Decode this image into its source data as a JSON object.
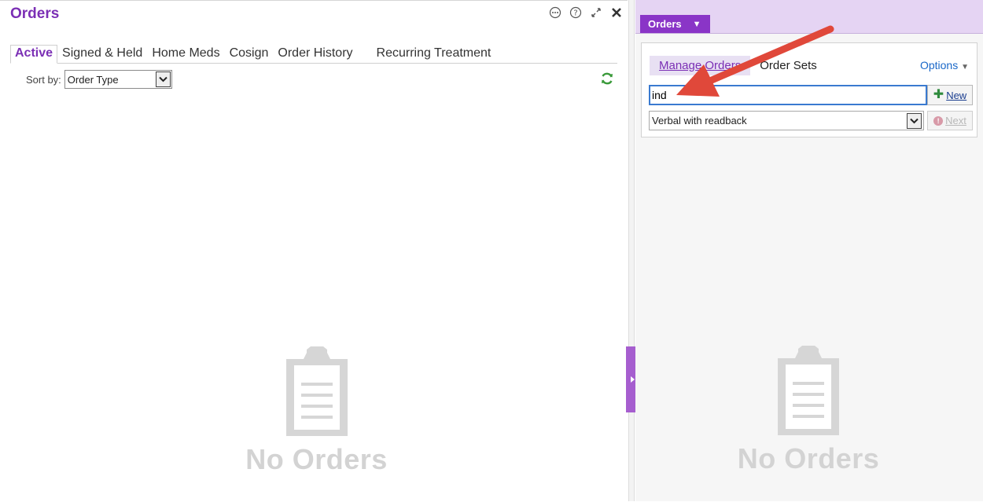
{
  "left": {
    "title": "Orders",
    "tabs": [
      "Active",
      "Signed & Held",
      "Home Meds",
      "Cosign",
      "Order History",
      "Recurring Treatment"
    ],
    "sort_label": "Sort by:",
    "sort_value": "Order Type",
    "empty_text": "No Orders"
  },
  "right": {
    "orders_menu": "Orders",
    "manage_orders": "Manage Orders",
    "order_sets": "Order Sets",
    "options": "Options",
    "search_value": "ind",
    "new_label": "New",
    "mode_value": "Verbal with readback",
    "next_label": "Next",
    "empty_text": "No Orders"
  },
  "colors": {
    "accent_purple": "#7b2fb5",
    "header_purple": "#8a35c7",
    "header_bg": "#e5d4f3",
    "link_blue": "#1a68c8",
    "arrow_red": "#e0483a"
  },
  "icons": {
    "more": "more-options-icon",
    "help": "help-icon",
    "expand": "expand-icon",
    "close": "close-icon",
    "refresh": "refresh-icon",
    "clipboard": "clipboard-icon",
    "plus": "plus-icon",
    "warning": "warning-icon"
  }
}
